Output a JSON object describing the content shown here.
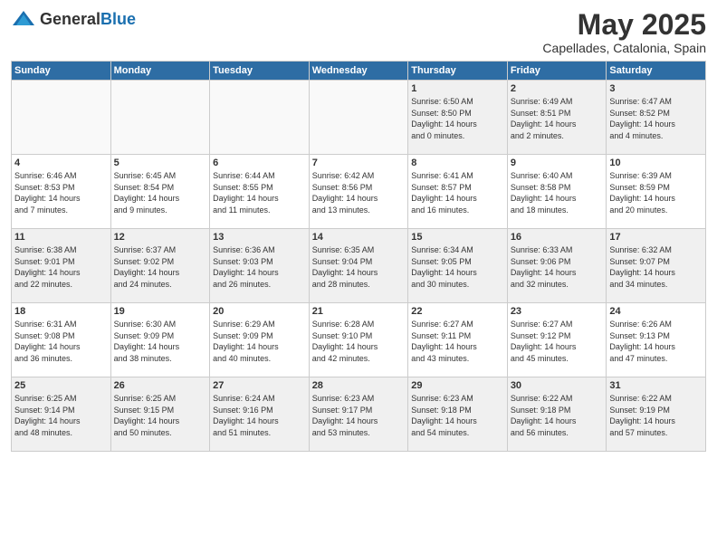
{
  "header": {
    "logo_general": "General",
    "logo_blue": "Blue",
    "title": "May 2025",
    "subtitle": "Capellades, Catalonia, Spain"
  },
  "weekdays": [
    "Sunday",
    "Monday",
    "Tuesday",
    "Wednesday",
    "Thursday",
    "Friday",
    "Saturday"
  ],
  "weeks": [
    [
      {
        "num": "",
        "info": "",
        "empty": true
      },
      {
        "num": "",
        "info": "",
        "empty": true
      },
      {
        "num": "",
        "info": "",
        "empty": true
      },
      {
        "num": "",
        "info": "",
        "empty": true
      },
      {
        "num": "1",
        "info": "Sunrise: 6:50 AM\nSunset: 8:50 PM\nDaylight: 14 hours\nand 0 minutes."
      },
      {
        "num": "2",
        "info": "Sunrise: 6:49 AM\nSunset: 8:51 PM\nDaylight: 14 hours\nand 2 minutes."
      },
      {
        "num": "3",
        "info": "Sunrise: 6:47 AM\nSunset: 8:52 PM\nDaylight: 14 hours\nand 4 minutes."
      }
    ],
    [
      {
        "num": "4",
        "info": "Sunrise: 6:46 AM\nSunset: 8:53 PM\nDaylight: 14 hours\nand 7 minutes."
      },
      {
        "num": "5",
        "info": "Sunrise: 6:45 AM\nSunset: 8:54 PM\nDaylight: 14 hours\nand 9 minutes."
      },
      {
        "num": "6",
        "info": "Sunrise: 6:44 AM\nSunset: 8:55 PM\nDaylight: 14 hours\nand 11 minutes."
      },
      {
        "num": "7",
        "info": "Sunrise: 6:42 AM\nSunset: 8:56 PM\nDaylight: 14 hours\nand 13 minutes."
      },
      {
        "num": "8",
        "info": "Sunrise: 6:41 AM\nSunset: 8:57 PM\nDaylight: 14 hours\nand 16 minutes."
      },
      {
        "num": "9",
        "info": "Sunrise: 6:40 AM\nSunset: 8:58 PM\nDaylight: 14 hours\nand 18 minutes."
      },
      {
        "num": "10",
        "info": "Sunrise: 6:39 AM\nSunset: 8:59 PM\nDaylight: 14 hours\nand 20 minutes."
      }
    ],
    [
      {
        "num": "11",
        "info": "Sunrise: 6:38 AM\nSunset: 9:01 PM\nDaylight: 14 hours\nand 22 minutes."
      },
      {
        "num": "12",
        "info": "Sunrise: 6:37 AM\nSunset: 9:02 PM\nDaylight: 14 hours\nand 24 minutes."
      },
      {
        "num": "13",
        "info": "Sunrise: 6:36 AM\nSunset: 9:03 PM\nDaylight: 14 hours\nand 26 minutes."
      },
      {
        "num": "14",
        "info": "Sunrise: 6:35 AM\nSunset: 9:04 PM\nDaylight: 14 hours\nand 28 minutes."
      },
      {
        "num": "15",
        "info": "Sunrise: 6:34 AM\nSunset: 9:05 PM\nDaylight: 14 hours\nand 30 minutes."
      },
      {
        "num": "16",
        "info": "Sunrise: 6:33 AM\nSunset: 9:06 PM\nDaylight: 14 hours\nand 32 minutes."
      },
      {
        "num": "17",
        "info": "Sunrise: 6:32 AM\nSunset: 9:07 PM\nDaylight: 14 hours\nand 34 minutes."
      }
    ],
    [
      {
        "num": "18",
        "info": "Sunrise: 6:31 AM\nSunset: 9:08 PM\nDaylight: 14 hours\nand 36 minutes."
      },
      {
        "num": "19",
        "info": "Sunrise: 6:30 AM\nSunset: 9:09 PM\nDaylight: 14 hours\nand 38 minutes."
      },
      {
        "num": "20",
        "info": "Sunrise: 6:29 AM\nSunset: 9:09 PM\nDaylight: 14 hours\nand 40 minutes."
      },
      {
        "num": "21",
        "info": "Sunrise: 6:28 AM\nSunset: 9:10 PM\nDaylight: 14 hours\nand 42 minutes."
      },
      {
        "num": "22",
        "info": "Sunrise: 6:27 AM\nSunset: 9:11 PM\nDaylight: 14 hours\nand 43 minutes."
      },
      {
        "num": "23",
        "info": "Sunrise: 6:27 AM\nSunset: 9:12 PM\nDaylight: 14 hours\nand 45 minutes."
      },
      {
        "num": "24",
        "info": "Sunrise: 6:26 AM\nSunset: 9:13 PM\nDaylight: 14 hours\nand 47 minutes."
      }
    ],
    [
      {
        "num": "25",
        "info": "Sunrise: 6:25 AM\nSunset: 9:14 PM\nDaylight: 14 hours\nand 48 minutes."
      },
      {
        "num": "26",
        "info": "Sunrise: 6:25 AM\nSunset: 9:15 PM\nDaylight: 14 hours\nand 50 minutes."
      },
      {
        "num": "27",
        "info": "Sunrise: 6:24 AM\nSunset: 9:16 PM\nDaylight: 14 hours\nand 51 minutes."
      },
      {
        "num": "28",
        "info": "Sunrise: 6:23 AM\nSunset: 9:17 PM\nDaylight: 14 hours\nand 53 minutes."
      },
      {
        "num": "29",
        "info": "Sunrise: 6:23 AM\nSunset: 9:18 PM\nDaylight: 14 hours\nand 54 minutes."
      },
      {
        "num": "30",
        "info": "Sunrise: 6:22 AM\nSunset: 9:18 PM\nDaylight: 14 hours\nand 56 minutes."
      },
      {
        "num": "31",
        "info": "Sunrise: 6:22 AM\nSunset: 9:19 PM\nDaylight: 14 hours\nand 57 minutes."
      }
    ]
  ]
}
